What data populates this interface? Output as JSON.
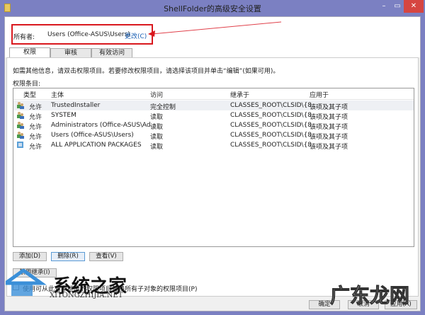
{
  "window": {
    "title": "ShellFolder的高级安全设置",
    "minimize": "–",
    "maximize": "▭",
    "close": "✕"
  },
  "owner": {
    "label": "所有者:",
    "value": "Users (Office-ASUS\\Users)",
    "change_link": "更改(C)"
  },
  "tabs": [
    {
      "label": "权限",
      "active": true
    },
    {
      "label": "审核",
      "active": false
    },
    {
      "label": "有效访问",
      "active": false
    }
  ],
  "description": "如需其他信息，请双击权限项目。若要修改权限项目，请选择该项目并单击“编辑”(如果可用)。",
  "list_label": "权限条目:",
  "columns": [
    "类型",
    "主体",
    "访问",
    "继承于",
    "应用于"
  ],
  "rows": [
    {
      "type": "允许",
      "principal": "TrustedInstaller",
      "access": "完全控制",
      "inherited": "CLASSES_ROOT\\CLSID\\{8...",
      "applies": "该项及其子项",
      "icon": "users-icon"
    },
    {
      "type": "允许",
      "principal": "SYSTEM",
      "access": "读取",
      "inherited": "CLASSES_ROOT\\CLSID\\{8...",
      "applies": "该项及其子项",
      "icon": "users-icon"
    },
    {
      "type": "允许",
      "principal": "Administrators (Office-ASUS\\Ad...",
      "access": "读取",
      "inherited": "CLASSES_ROOT\\CLSID\\{8...",
      "applies": "该项及其子项",
      "icon": "users-icon"
    },
    {
      "type": "允许",
      "principal": "Users (Office-ASUS\\Users)",
      "access": "读取",
      "inherited": "CLASSES_ROOT\\CLSID\\{8...",
      "applies": "该项及其子项",
      "icon": "users-icon"
    },
    {
      "type": "允许",
      "principal": "ALL APPLICATION PACKAGES",
      "access": "读取",
      "inherited": "CLASSES_ROOT\\CLSID\\{8...",
      "applies": "该项及其子项",
      "icon": "package-icon"
    }
  ],
  "buttons": {
    "add": "添加(D)",
    "remove": "删除(R)",
    "view": "查看(V)",
    "disable_inheritance": "禁用继承(I)",
    "ok": "确定",
    "cancel": "取消",
    "apply": "应用(A)"
  },
  "replace_checkbox": {
    "label": "使用可从此对象继承的权限项目替换所有子对象的权限项目(P)",
    "checked": false
  },
  "watermarks": {
    "site1": "系统之家",
    "site1_url": "XITONGZHIJIA.NET",
    "site2": "广东龙网"
  },
  "colors": {
    "frame": "#7b80c2",
    "close": "#d64541",
    "highlight": "#d9181e",
    "link": "#1a5fb4"
  }
}
